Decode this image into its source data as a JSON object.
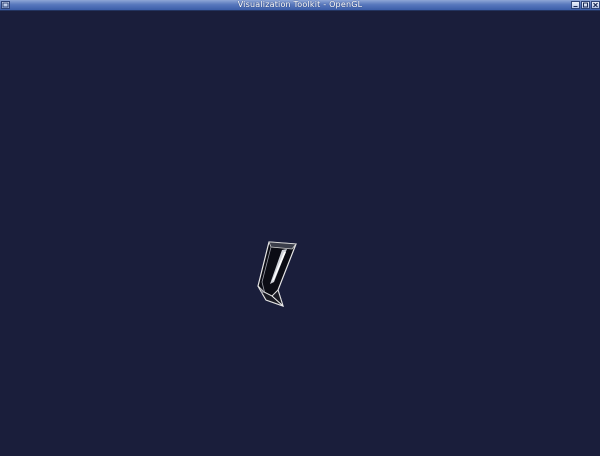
{
  "window": {
    "title": "Visualization Toolkit - OpenGL"
  },
  "icons": {
    "system_menu": "window-menu-icon",
    "minimize": "minimize-icon",
    "maximize": "maximize-icon",
    "close": "close-icon"
  },
  "colors": {
    "background": "#1a1e3b",
    "titlebar": "#5878bd",
    "object_outline": "#e8e8e8"
  }
}
